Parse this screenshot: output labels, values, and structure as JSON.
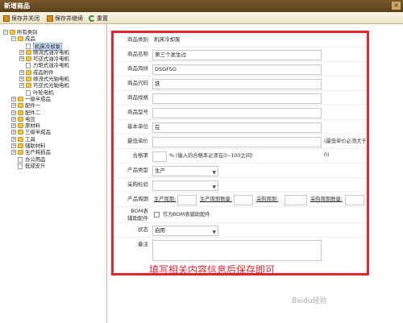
{
  "window": {
    "title": "新增商品",
    "close_glyph": "×"
  },
  "toolbar": {
    "save_close": "保存并关闭",
    "save_continue": "保存并继续",
    "reset": "重置"
  },
  "tree": [
    {
      "label": "所有类别",
      "depth": 0,
      "icon": "folder",
      "expander": "−"
    },
    {
      "label": "成品",
      "depth": 1,
      "icon": "folder",
      "expander": "−"
    },
    {
      "label": "机床冷却泵",
      "depth": 2,
      "icon": "doc",
      "selected": true
    },
    {
      "label": "顺流式油冷电机",
      "depth": 2,
      "icon": "folder",
      "expander": "+"
    },
    {
      "label": "可逆式油冷电机",
      "depth": 2,
      "icon": "folder",
      "expander": "+"
    },
    {
      "label": "力矩式油冷电机",
      "depth": 2,
      "icon": "doc"
    },
    {
      "label": "成品附件",
      "depth": 2,
      "icon": "folder",
      "expander": "+"
    },
    {
      "label": "顺流式光轴电机",
      "depth": 2,
      "icon": "folder",
      "expander": "+"
    },
    {
      "label": "可逆式光轴电机",
      "depth": 2,
      "icon": "folder",
      "expander": "+"
    },
    {
      "label": "叶轮电机",
      "depth": 2,
      "icon": "doc"
    },
    {
      "label": "一级半成品",
      "depth": 1,
      "icon": "folder",
      "expander": "+"
    },
    {
      "label": "配件一",
      "depth": 1,
      "icon": "folder",
      "expander": "+"
    },
    {
      "label": "配件二",
      "depth": 1,
      "icon": "folder",
      "expander": "+"
    },
    {
      "label": "电压",
      "depth": 1,
      "icon": "folder",
      "expander": "+"
    },
    {
      "label": "原材料",
      "depth": 1,
      "icon": "folder",
      "expander": "+"
    },
    {
      "label": "三级半成品",
      "depth": 1,
      "icon": "folder",
      "expander": "+"
    },
    {
      "label": "工具",
      "depth": 1,
      "icon": "folder",
      "expander": "+"
    },
    {
      "label": "辅助材料",
      "depth": 1,
      "icon": "folder",
      "expander": "+"
    },
    {
      "label": "生产耗损品",
      "depth": 1,
      "icon": "folder",
      "expander": "+"
    },
    {
      "label": "办公用品",
      "depth": 1,
      "icon": "doc"
    },
    {
      "label": "低成安斤",
      "depth": 1,
      "icon": "doc"
    }
  ],
  "form": {
    "category_label": "商品类别",
    "category_value": "机床冷却泵",
    "name_label": "商品名称",
    "name_value": "第三个发生过",
    "abbr_label": "商品简拼",
    "abbr_value": "DSGFSG",
    "code_label": "商品代码",
    "code_value": "铁",
    "spec_label": "商品规格",
    "spec_value": "",
    "model_label": "商品型号",
    "model_value": "",
    "unit_label": "基本单位",
    "unit_value": "在",
    "min_price_label": "最低单价",
    "min_price_value": "",
    "min_price_note": "(最低单价必须大于0)",
    "pass_rate_label": "合格率",
    "pass_rate_value": "",
    "pass_rate_note": "% (输入的合格率必须在0~100之间)",
    "prod_type_label": "产品类型",
    "prod_type_value": "生产",
    "purchase_check_label": "采购检验",
    "purchase_check_value": "",
    "cycle_label": "产品周期",
    "prod_cycle_label": "生产周期:",
    "prod_cycle_qty_label": "生产周期数量:",
    "purchase_cycle_label": "采购周期:",
    "purchase_cycle_qty_label": "采购周期数量:",
    "bom_label_1": "BOM表",
    "bom_label_2": "辅助配件",
    "bom_checkbox_label": "作为BOM表辅助配件",
    "status_label": "状态",
    "status_value": "启用",
    "remark_label": "备注",
    "remark_value": ""
  },
  "caption": "填写相关内容信息后保存即可",
  "watermark": "Baidu经验",
  "colors": {
    "highlight_border": "#e3262c",
    "titlebar": "#6a4c22",
    "caption": "#e3262c"
  }
}
